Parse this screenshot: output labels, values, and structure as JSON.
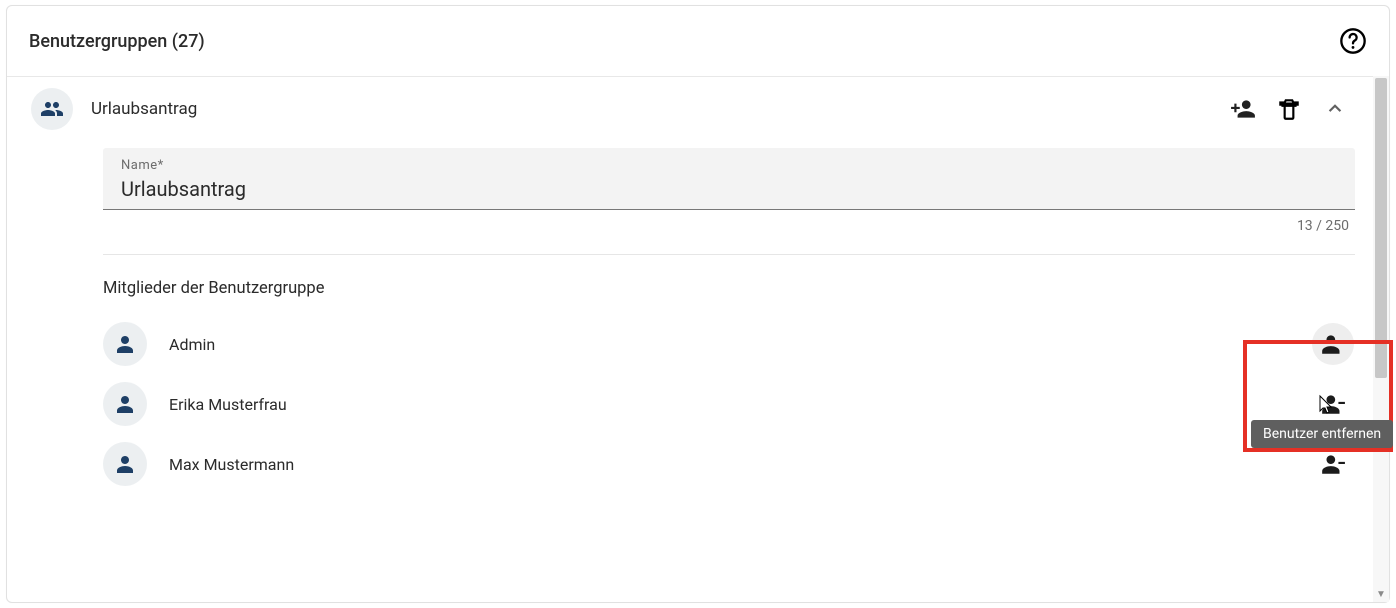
{
  "header": {
    "title": "Benutzergruppen (27)"
  },
  "group": {
    "title": "Urlaubsantrag",
    "nameField": {
      "label": "Name*",
      "value": "Urlaubsantrag",
      "counter": "13 / 250"
    },
    "membersSectionTitle": "Mitglieder der Benutzergruppe",
    "members": [
      {
        "name": "Admin"
      },
      {
        "name": "Erika Musterfrau"
      },
      {
        "name": "Max Mustermann"
      }
    ]
  },
  "tooltip": {
    "removeUser": "Benutzer entfernen"
  },
  "icons": {
    "help": "help-icon",
    "group": "group-icon",
    "person": "person-icon",
    "personAdd": "person-add-icon",
    "personRemove": "person-remove-icon",
    "delete": "delete-icon",
    "chevronUp": "chevron-up-icon"
  }
}
